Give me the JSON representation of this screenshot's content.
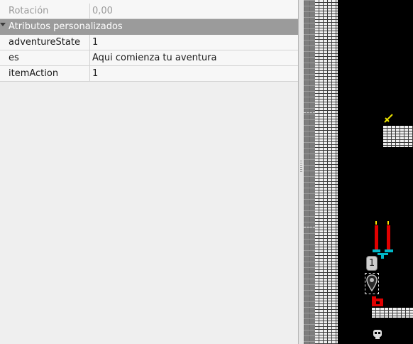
{
  "properties": {
    "rotation": {
      "label": "Rotación",
      "value": "0,00"
    },
    "group_label": "Atributos personalizados",
    "custom": [
      {
        "label": "adventureState",
        "value": "1"
      },
      {
        "label": "es",
        "value": "Aqui comienza tu aventura"
      },
      {
        "label": "itemAction",
        "value": "1"
      }
    ]
  },
  "map": {
    "marker_label": "1",
    "colors": {
      "background": "#000000",
      "brick": "#efefef",
      "candle": "#e00000",
      "flame": "#ffe000",
      "candelabra": "#00b8c8",
      "grid": "#7d7d7d"
    },
    "icons": [
      "sword-icon",
      "candle-icon",
      "location-pin-icon",
      "chest-icon",
      "skull-icon"
    ]
  }
}
